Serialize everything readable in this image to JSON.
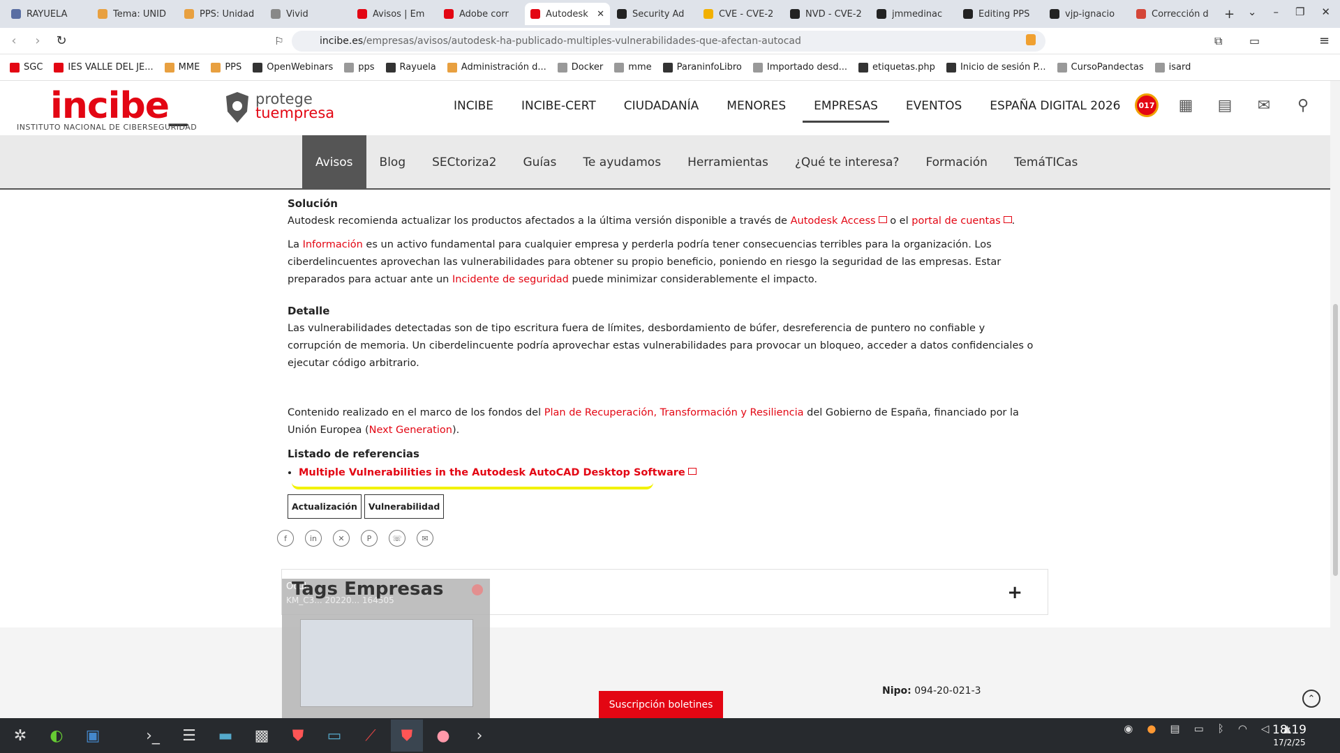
{
  "browser": {
    "tabs": [
      {
        "title": "RAYUELA",
        "color": "#5a6ea3"
      },
      {
        "title": "Tema: UNID",
        "color": "#e8a040"
      },
      {
        "title": "PPS: Unidad",
        "color": "#e8a040"
      },
      {
        "title": "Vivid",
        "color": "#888888"
      },
      {
        "title": "Avisos | Em",
        "color": "#e30613"
      },
      {
        "title": "Adobe corr",
        "color": "#e30613"
      },
      {
        "title": "Autodesk",
        "color": "#e30613",
        "active": true
      },
      {
        "title": "Security Ad",
        "color": "#222222"
      },
      {
        "title": "CVE - CVE-2",
        "color": "#f2b000"
      },
      {
        "title": "NVD - CVE-2",
        "color": "#222222"
      },
      {
        "title": "jmmedinac",
        "color": "#222222"
      },
      {
        "title": "Editing PPS",
        "color": "#222222"
      },
      {
        "title": "vjp-ignacio",
        "color": "#222222"
      },
      {
        "title": "Corrección d",
        "color": "#d44638"
      }
    ],
    "url_host": "incibe.es",
    "url_path": "/empresas/avisos/autodesk-ha-publicado-multiples-vulnerabilidades-que-afectan-autocad",
    "bookmarks": [
      "SGC",
      "IES VALLE DEL JE...",
      "MME",
      "PPS",
      "OpenWebinars",
      "pps",
      "Rayuela",
      "Administración d...",
      "Docker",
      "mme",
      "ParaninfoLibro",
      "Importado desd...",
      "etiquetas.php",
      "Inicio de sesión P...",
      "CursoPandectas",
      "isard"
    ]
  },
  "header": {
    "logo_text": "incibe",
    "logo_underscore": "_",
    "logo_subtitle": "INSTITUTO NACIONAL DE CIBERSEGURIDAD",
    "protege_line1": "protege",
    "protege_line2": "tuempresa",
    "nav": [
      "INCIBE",
      "INCIBE-CERT",
      "CIUDADANÍA",
      "MENORES",
      "EMPRESAS",
      "EVENTOS",
      "ESPAÑA DIGITAL 2026"
    ],
    "badge_017": "017"
  },
  "subnav": [
    "Avisos",
    "Blog",
    "SECtoriza2",
    "Guías",
    "Te ayudamos",
    "Herramientas",
    "¿Qué te interesa?",
    "Formación",
    "TemáTICas"
  ],
  "article": {
    "solucion_title": "Solución",
    "solucion_pre": "Autodesk recomienda actualizar los productos afectados a la última versión disponible a través de ",
    "link_access": "Autodesk Access",
    "solucion_mid": " o el ",
    "link_portal": "portal de cuentas",
    "solucion_end": ".",
    "info_pre": "La ",
    "link_info": "Información",
    "info_mid": " es un activo fundamental para cualquier empresa y perderla podría tener consecuencias terribles para la organización. Los ciberdelincuentes aprovechan las vulnerabilidades para obtener su propio beneficio, poniendo en riesgo la seguridad de las empresas. Estar preparados para actuar ante un ",
    "link_incidente": "Incidente de seguridad",
    "info_end": " puede minimizar considerablemente el impacto.",
    "detalle_title": "Detalle",
    "detalle_text": "Las vulnerabilidades detectadas son de tipo escritura fuera de límites, desbordamiento de búfer, desreferencia de puntero no confiable y corrupción de memoria. Un ciberdelincuente podría aprovechar estas vulnerabilidades para provocar un bloqueo, acceder a datos confidenciales o ejecutar código arbitrario.",
    "fondos_pre": "Contenido realizado en el marco de los fondos del ",
    "link_plan": "Plan de Recuperación, Transformación y Resiliencia",
    "fondos_mid": " del Gobierno de España, financiado por la Unión Europea (",
    "link_nextgen": "Next Generation",
    "fondos_end": ").",
    "refs_title": "Listado de referencias",
    "ref_link": "Multiple Vulnerabilities in the Autodesk AutoCAD Desktop Software",
    "tags": [
      "Actualización",
      "Vulnerabilidad"
    ]
  },
  "tags_box_title": "Tags Empresas",
  "footer": {
    "subscribe": "Suscripción boletines",
    "nipo_label": "Nipo:",
    "nipo_value": "094-20-021-3"
  },
  "popup": {
    "name": "Ocul",
    "file": "KM_C3... 20220... 164505"
  },
  "taskbar": {
    "time": "18:19",
    "date": "17/2/25"
  }
}
